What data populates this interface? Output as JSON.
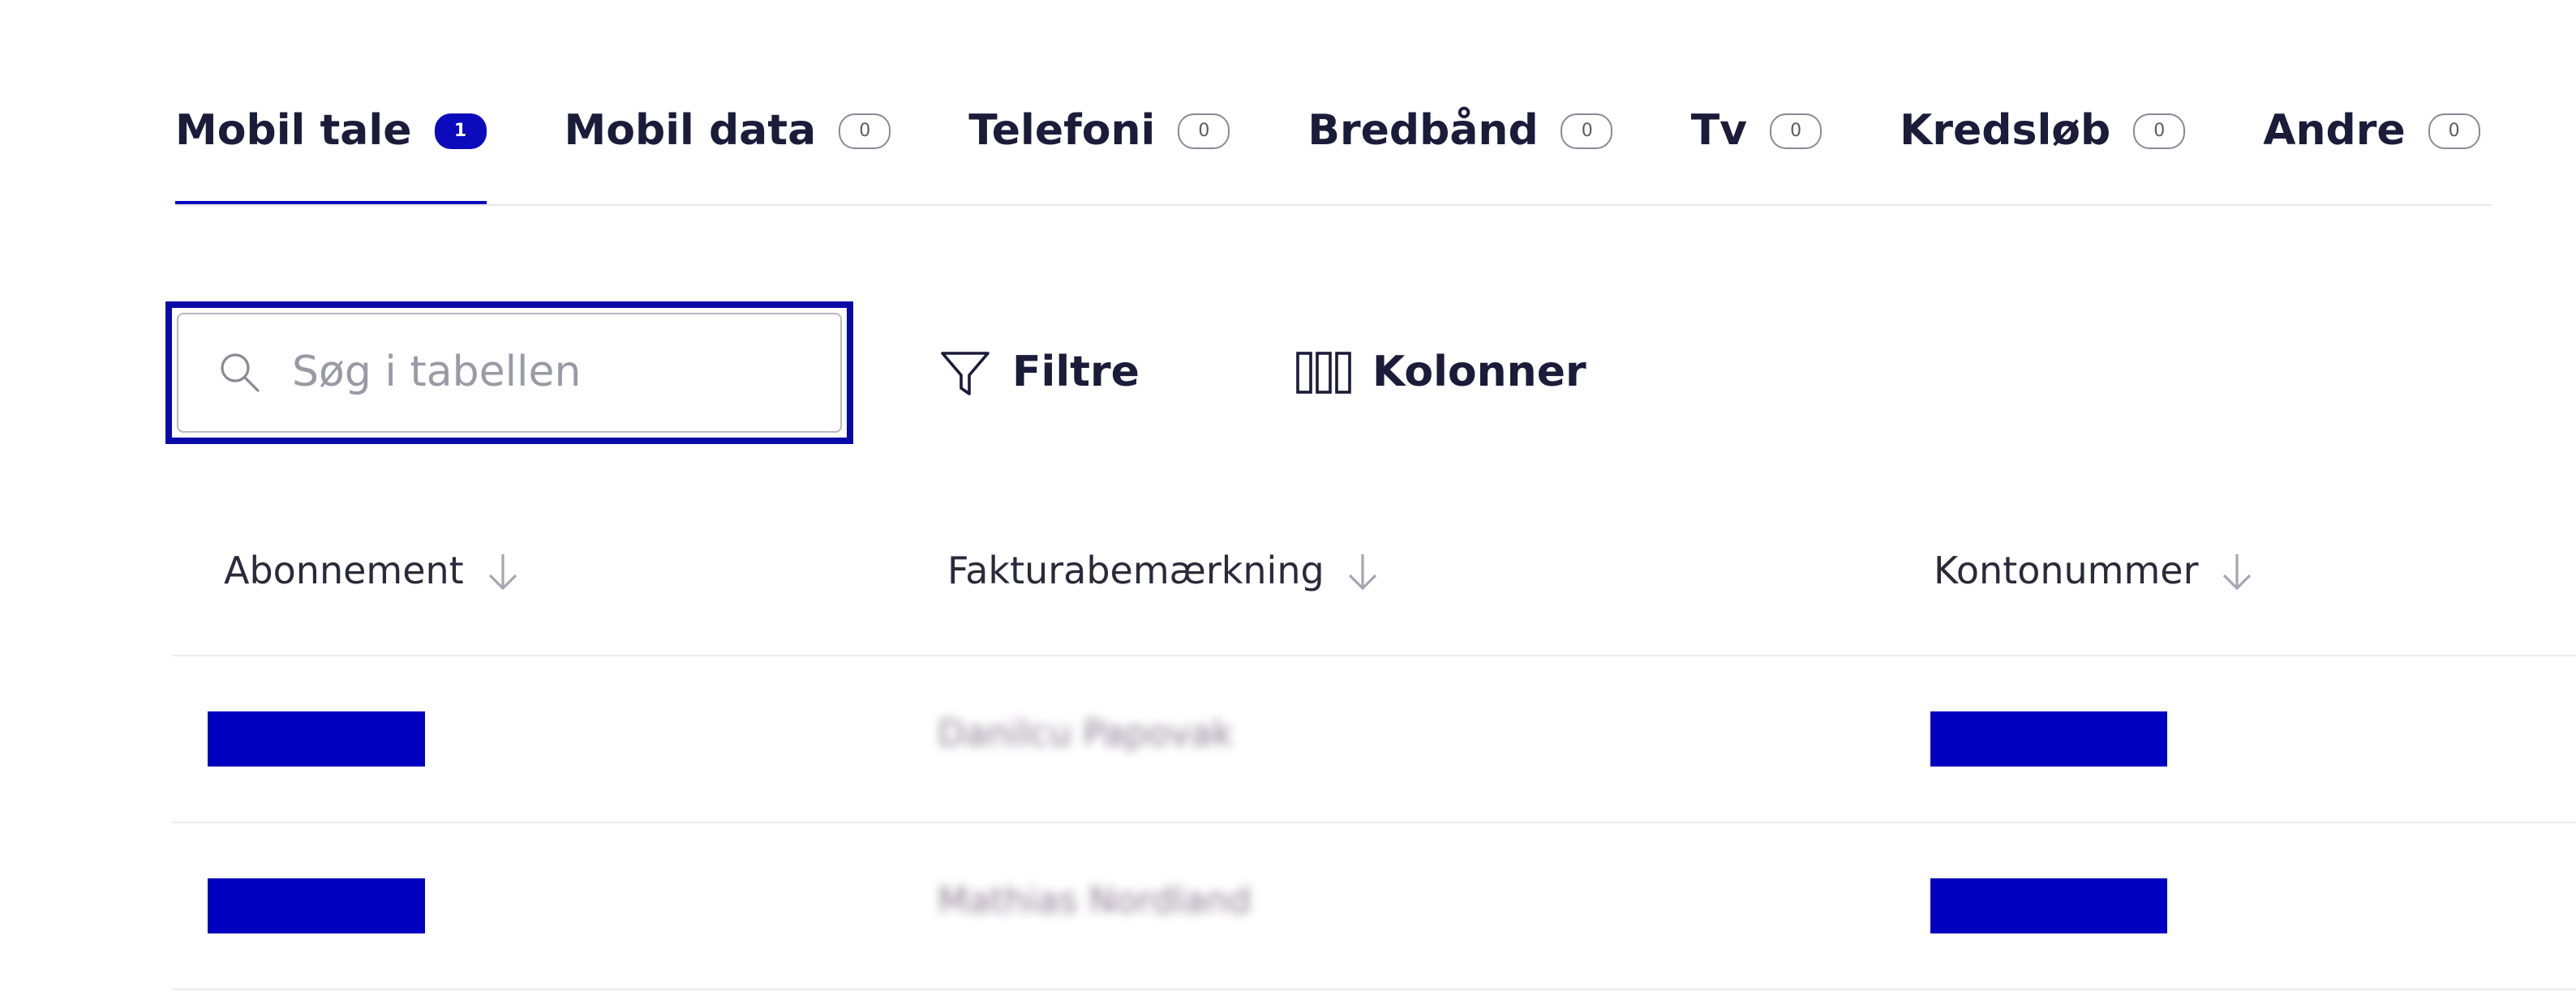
{
  "tabs": [
    {
      "label": "Mobil tale",
      "count": "1",
      "active": true
    },
    {
      "label": "Mobil data",
      "count": "0",
      "active": false
    },
    {
      "label": "Telefoni",
      "count": "0",
      "active": false
    },
    {
      "label": "Bredbånd",
      "count": "0",
      "active": false
    },
    {
      "label": "Tv",
      "count": "0",
      "active": false
    },
    {
      "label": "Kredsløb",
      "count": "0",
      "active": false
    },
    {
      "label": "Andre",
      "count": "0",
      "active": false
    }
  ],
  "toolbar": {
    "search_placeholder": "Søg i tabellen",
    "search_value": "",
    "filters_label": "Filtre",
    "columns_label": "Kolonner",
    "search_icon": "search-icon",
    "filter_icon": "funnel-icon",
    "columns_icon": "columns-icon"
  },
  "table": {
    "columns": [
      "Abonnement",
      "Fakturabemærkning",
      "Kontonummer"
    ],
    "rows": [
      {
        "abonnement": "",
        "fakturabemaerkning": "Danilcu Papovak",
        "kontonummer": ""
      },
      {
        "abonnement": "",
        "fakturabemaerkning": "Mathias Nordland",
        "kontonummer": ""
      }
    ]
  },
  "colors": {
    "accent": "#0b0bbd",
    "redaction": "#0000c0",
    "focus_outline": "#0a0aa8"
  }
}
